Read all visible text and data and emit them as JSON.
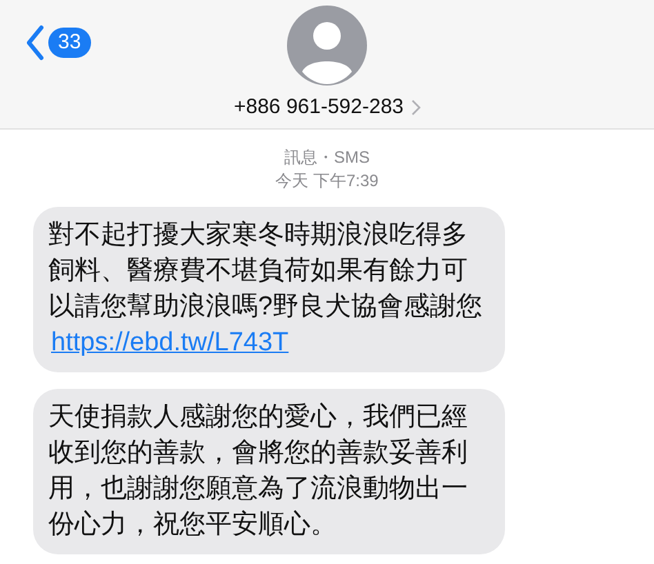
{
  "header": {
    "back_badge": "33",
    "contact": "+886 961-592-283"
  },
  "service": "訊息・SMS",
  "timestamp": "今天 下午7:39",
  "messages": [
    {
      "text": "對不起打擾大家寒冬時期浪浪吃得多飼料、醫療費不堪負荷如果有餘力可以請您幫助浪浪嗎?野良犬協會感謝您",
      "link": "https://ebd.tw/L743T"
    },
    {
      "text": "天使捐款人感謝您的愛心，我們已經收到您的善款，會將您的善款妥善利用，也謝謝您願意為了流浪動物出一份心力，祝您平安順心。"
    }
  ]
}
